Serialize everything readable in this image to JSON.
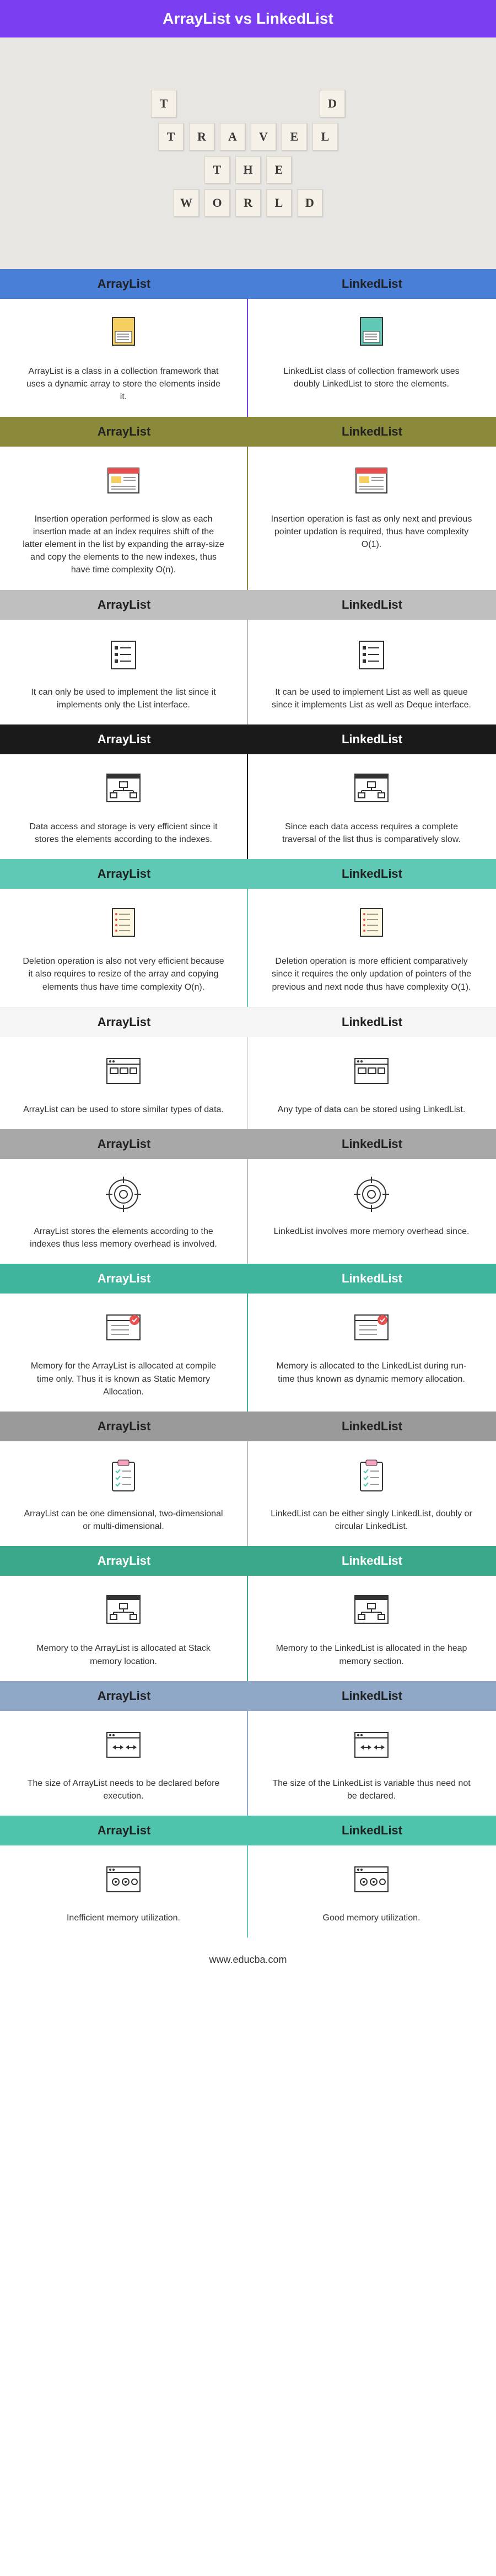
{
  "title": "ArrayList vs LinkedList",
  "hero_tiles": {
    "row1": [
      "T",
      "D"
    ],
    "row2": [
      "T",
      "R",
      "A",
      "V",
      "E",
      "L"
    ],
    "row3": [
      "T",
      "H",
      "E"
    ],
    "row4": [
      "W",
      "O",
      "R",
      "L",
      "D"
    ]
  },
  "labels": {
    "left": "ArrayList",
    "right": "LinkedList"
  },
  "rows": [
    {
      "hdr_class": "hdr-blue",
      "div_class": "div-purple",
      "left": "ArrayList is a class in a collection framework that uses a dynamic array to store the elements inside it.",
      "right": "LinkedList class of collection framework uses doubly LinkedList to store the elements."
    },
    {
      "hdr_class": "hdr-olive",
      "div_class": "div-olive",
      "left": "Insertion operation performed is slow as each insertion made at an index requires shift of the latter element in the list by expanding the array-size and copy the elements to the new indexes, thus have time complexity O(n).",
      "right": "Insertion operation is fast as only next and previous pointer updation is required, thus have complexity O(1)."
    },
    {
      "hdr_class": "hdr-gray",
      "div_class": "div-gray",
      "left": "It can only be used to implement the list since it implements only the List interface.",
      "right": "It can be used to implement List as well as queue since it implements List as well as Deque interface."
    },
    {
      "hdr_class": "hdr-black",
      "div_class": "div-black",
      "left": "Data access and storage is very efficient since it stores the elements according to the indexes.",
      "right": "Since each data access requires a complete traversal of the list thus is comparatively slow."
    },
    {
      "hdr_class": "hdr-teal-light",
      "div_class": "div-teal",
      "left": "Deletion operation is also not very efficient because it also requires to resize of the array and copying elements thus have time complexity O(n).",
      "right": "Deletion operation is more efficient comparatively since it requires the only updation of pointers of the previous and next node thus have complexity O(1)."
    },
    {
      "hdr_class": "hdr-white",
      "div_class": "div-white",
      "left": "ArrayList can be used to store similar types of data.",
      "right": "Any type of data can be stored using LinkedList."
    },
    {
      "hdr_class": "hdr-graymid",
      "div_class": "div-gray",
      "left": "ArrayList stores the elements according to the indexes thus less memory overhead is involved.",
      "right": "LinkedList involves more memory overhead since."
    },
    {
      "hdr_class": "hdr-teal",
      "div_class": "div-teal2",
      "left": "Memory for the ArrayList is allocated at compile time only. Thus it is known as Static Memory Allocation.",
      "right": "Memory is allocated to the LinkedList during run-time thus known as dynamic memory allocation."
    },
    {
      "hdr_class": "hdr-darkgray",
      "div_class": "div-gray",
      "left": "ArrayList can be one dimensional, two-dimensional or multi-dimensional.",
      "right": "LinkedList can be either singly LinkedList, doubly or circular LinkedList."
    },
    {
      "hdr_class": "hdr-green",
      "div_class": "div-green",
      "left": "Memory to the ArrayList is allocated at Stack memory location.",
      "right": "Memory to the LinkedList is allocated in the heap memory section."
    },
    {
      "hdr_class": "hdr-bluegray",
      "div_class": "div-bluegray",
      "left": "The size of ArrayList needs to be declared before execution.",
      "right": "The size of the LinkedList is variable thus need not be declared."
    },
    {
      "hdr_class": "hdr-teal2",
      "div_class": "div-teal",
      "left": "Inefficient memory utilization.",
      "right": "Good memory utilization."
    }
  ],
  "footer": "www.educba.com",
  "icons": [
    {
      "left": "file-yellow",
      "right": "file-teal"
    },
    {
      "left": "browser-red",
      "right": "browser-red"
    },
    {
      "left": "list-box",
      "right": "list-box"
    },
    {
      "left": "org-chart",
      "right": "org-chart"
    },
    {
      "left": "list-paper",
      "right": "list-paper"
    },
    {
      "left": "browser-dots",
      "right": "browser-dots"
    },
    {
      "left": "target",
      "right": "target"
    },
    {
      "left": "browser-check",
      "right": "browser-check"
    },
    {
      "left": "clipboard",
      "right": "clipboard"
    },
    {
      "left": "org-chart",
      "right": "org-chart"
    },
    {
      "left": "arrows-box",
      "right": "arrows-box"
    },
    {
      "left": "gear-box",
      "right": "gear-box"
    }
  ]
}
